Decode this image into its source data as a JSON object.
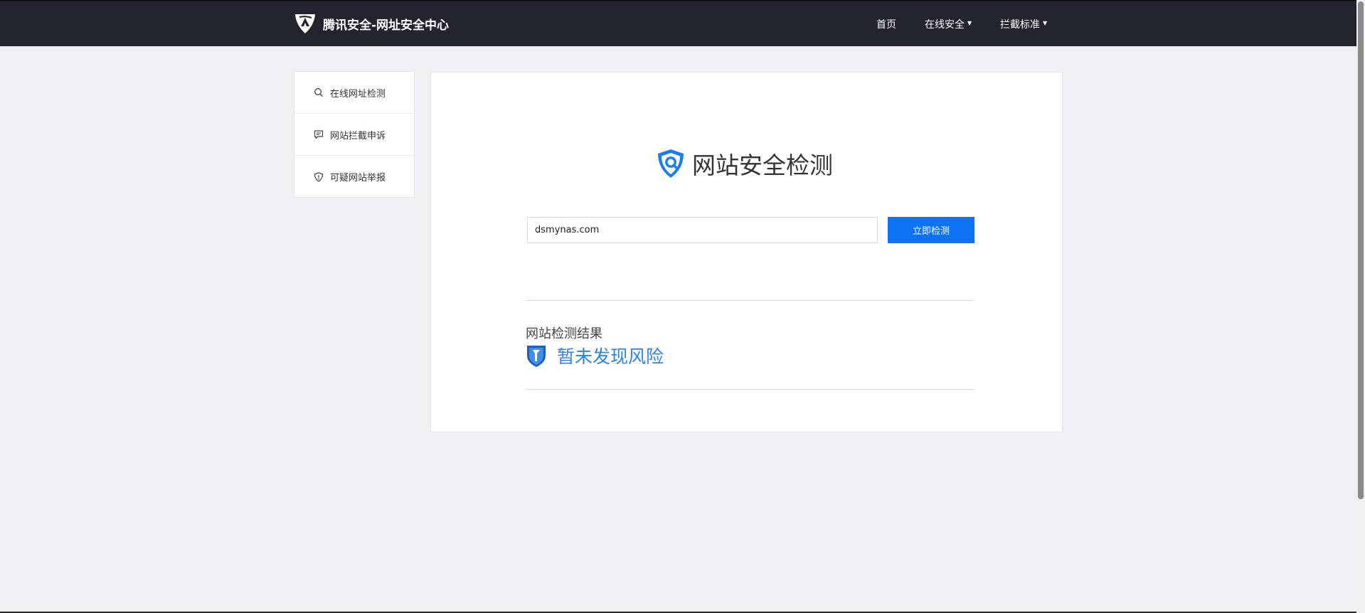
{
  "header": {
    "brand_title": "腾讯安全-网址安全中心",
    "nav": {
      "home": "首页",
      "online_security": "在线安全",
      "block_standard": "拦截标准"
    }
  },
  "sidebar": {
    "items": [
      {
        "label": "在线网址检测",
        "icon": "search-icon"
      },
      {
        "label": "网站拦截申诉",
        "icon": "message-icon"
      },
      {
        "label": "可疑网站举报",
        "icon": "shield-alert-icon"
      }
    ]
  },
  "main": {
    "title": "网站安全检测",
    "url_value": "dsmynas.com",
    "check_button": "立即检测",
    "result_label": "网站检测结果",
    "result_text": "暂未发现风险"
  },
  "colors": {
    "topbar": "#23252e",
    "accent": "#0e72f5",
    "result_blue": "#2a84e8",
    "page_bg": "#efeff4"
  }
}
